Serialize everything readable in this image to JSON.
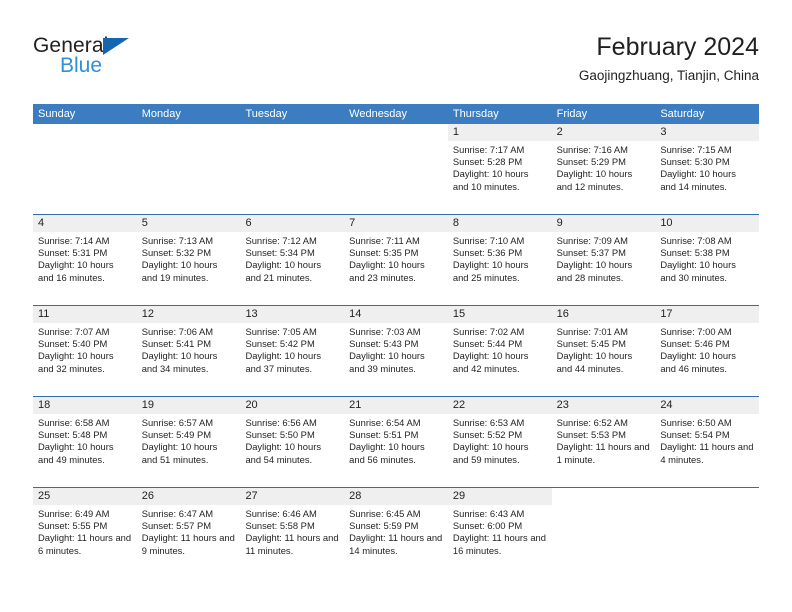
{
  "brand": {
    "name_top": "General",
    "name_bottom": "Blue",
    "accent_color": "#2f8fd8",
    "triangle_color": "#1466b0"
  },
  "header": {
    "title": "February 2024",
    "subtitle": "Gaojingzhuang, Tianjin, China"
  },
  "calendar": {
    "header_color": "#3b7dc0",
    "weekdays": [
      "Sunday",
      "Monday",
      "Tuesday",
      "Wednesday",
      "Thursday",
      "Friday",
      "Saturday"
    ],
    "weeks": [
      {
        "days": [
          {
            "blank": true
          },
          {
            "blank": true
          },
          {
            "blank": true
          },
          {
            "blank": true
          },
          {
            "num": "1",
            "sunrise": "Sunrise: 7:17 AM",
            "sunset": "Sunset: 5:28 PM",
            "daylight": "Daylight: 10 hours and 10 minutes."
          },
          {
            "num": "2",
            "sunrise": "Sunrise: 7:16 AM",
            "sunset": "Sunset: 5:29 PM",
            "daylight": "Daylight: 10 hours and 12 minutes."
          },
          {
            "num": "3",
            "sunrise": "Sunrise: 7:15 AM",
            "sunset": "Sunset: 5:30 PM",
            "daylight": "Daylight: 10 hours and 14 minutes."
          }
        ]
      },
      {
        "days": [
          {
            "num": "4",
            "sunrise": "Sunrise: 7:14 AM",
            "sunset": "Sunset: 5:31 PM",
            "daylight": "Daylight: 10 hours and 16 minutes."
          },
          {
            "num": "5",
            "sunrise": "Sunrise: 7:13 AM",
            "sunset": "Sunset: 5:32 PM",
            "daylight": "Daylight: 10 hours and 19 minutes."
          },
          {
            "num": "6",
            "sunrise": "Sunrise: 7:12 AM",
            "sunset": "Sunset: 5:34 PM",
            "daylight": "Daylight: 10 hours and 21 minutes."
          },
          {
            "num": "7",
            "sunrise": "Sunrise: 7:11 AM",
            "sunset": "Sunset: 5:35 PM",
            "daylight": "Daylight: 10 hours and 23 minutes."
          },
          {
            "num": "8",
            "sunrise": "Sunrise: 7:10 AM",
            "sunset": "Sunset: 5:36 PM",
            "daylight": "Daylight: 10 hours and 25 minutes."
          },
          {
            "num": "9",
            "sunrise": "Sunrise: 7:09 AM",
            "sunset": "Sunset: 5:37 PM",
            "daylight": "Daylight: 10 hours and 28 minutes."
          },
          {
            "num": "10",
            "sunrise": "Sunrise: 7:08 AM",
            "sunset": "Sunset: 5:38 PM",
            "daylight": "Daylight: 10 hours and 30 minutes."
          }
        ]
      },
      {
        "days": [
          {
            "num": "11",
            "sunrise": "Sunrise: 7:07 AM",
            "sunset": "Sunset: 5:40 PM",
            "daylight": "Daylight: 10 hours and 32 minutes."
          },
          {
            "num": "12",
            "sunrise": "Sunrise: 7:06 AM",
            "sunset": "Sunset: 5:41 PM",
            "daylight": "Daylight: 10 hours and 34 minutes."
          },
          {
            "num": "13",
            "sunrise": "Sunrise: 7:05 AM",
            "sunset": "Sunset: 5:42 PM",
            "daylight": "Daylight: 10 hours and 37 minutes."
          },
          {
            "num": "14",
            "sunrise": "Sunrise: 7:03 AM",
            "sunset": "Sunset: 5:43 PM",
            "daylight": "Daylight: 10 hours and 39 minutes."
          },
          {
            "num": "15",
            "sunrise": "Sunrise: 7:02 AM",
            "sunset": "Sunset: 5:44 PM",
            "daylight": "Daylight: 10 hours and 42 minutes."
          },
          {
            "num": "16",
            "sunrise": "Sunrise: 7:01 AM",
            "sunset": "Sunset: 5:45 PM",
            "daylight": "Daylight: 10 hours and 44 minutes."
          },
          {
            "num": "17",
            "sunrise": "Sunrise: 7:00 AM",
            "sunset": "Sunset: 5:46 PM",
            "daylight": "Daylight: 10 hours and 46 minutes."
          }
        ]
      },
      {
        "days": [
          {
            "num": "18",
            "sunrise": "Sunrise: 6:58 AM",
            "sunset": "Sunset: 5:48 PM",
            "daylight": "Daylight: 10 hours and 49 minutes."
          },
          {
            "num": "19",
            "sunrise": "Sunrise: 6:57 AM",
            "sunset": "Sunset: 5:49 PM",
            "daylight": "Daylight: 10 hours and 51 minutes."
          },
          {
            "num": "20",
            "sunrise": "Sunrise: 6:56 AM",
            "sunset": "Sunset: 5:50 PM",
            "daylight": "Daylight: 10 hours and 54 minutes."
          },
          {
            "num": "21",
            "sunrise": "Sunrise: 6:54 AM",
            "sunset": "Sunset: 5:51 PM",
            "daylight": "Daylight: 10 hours and 56 minutes."
          },
          {
            "num": "22",
            "sunrise": "Sunrise: 6:53 AM",
            "sunset": "Sunset: 5:52 PM",
            "daylight": "Daylight: 10 hours and 59 minutes."
          },
          {
            "num": "23",
            "sunrise": "Sunrise: 6:52 AM",
            "sunset": "Sunset: 5:53 PM",
            "daylight": "Daylight: 11 hours and 1 minute."
          },
          {
            "num": "24",
            "sunrise": "Sunrise: 6:50 AM",
            "sunset": "Sunset: 5:54 PM",
            "daylight": "Daylight: 11 hours and 4 minutes."
          }
        ]
      },
      {
        "days": [
          {
            "num": "25",
            "sunrise": "Sunrise: 6:49 AM",
            "sunset": "Sunset: 5:55 PM",
            "daylight": "Daylight: 11 hours and 6 minutes."
          },
          {
            "num": "26",
            "sunrise": "Sunrise: 6:47 AM",
            "sunset": "Sunset: 5:57 PM",
            "daylight": "Daylight: 11 hours and 9 minutes."
          },
          {
            "num": "27",
            "sunrise": "Sunrise: 6:46 AM",
            "sunset": "Sunset: 5:58 PM",
            "daylight": "Daylight: 11 hours and 11 minutes."
          },
          {
            "num": "28",
            "sunrise": "Sunrise: 6:45 AM",
            "sunset": "Sunset: 5:59 PM",
            "daylight": "Daylight: 11 hours and 14 minutes."
          },
          {
            "num": "29",
            "sunrise": "Sunrise: 6:43 AM",
            "sunset": "Sunset: 6:00 PM",
            "daylight": "Daylight: 11 hours and 16 minutes."
          },
          {
            "blank": true
          },
          {
            "blank": true
          }
        ]
      }
    ]
  }
}
